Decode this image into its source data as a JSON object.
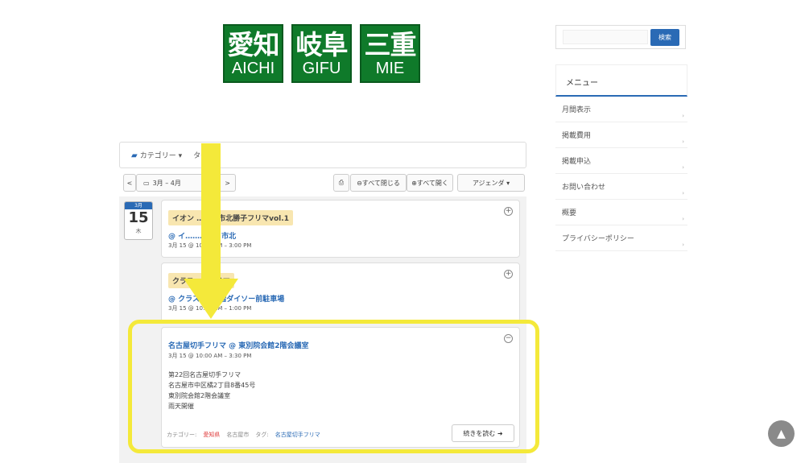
{
  "logos": [
    {
      "kanji": "愛知",
      "roman": "AICHI"
    },
    {
      "kanji": "岐阜",
      "roman": "GIFU"
    },
    {
      "kanji": "三重",
      "roman": "MIE"
    }
  ],
  "filter_bar": {
    "category_label": "カテゴリー ▾",
    "tag_label": "タグ ▾"
  },
  "nav": {
    "prev": "<",
    "range": "3月 – 4月",
    "next": ">",
    "print_icon": "printer-icon",
    "collapse_all": "⊖すべて閉じる",
    "expand_all": "⊕すべて開く",
    "view": "アジェンダ ▾"
  },
  "date_badge": {
    "month": "3月",
    "day": "15",
    "weekday": "木"
  },
  "events": [
    {
      "title": "イオン ……日市北勝子フリマvol.1",
      "location": "@ イ…………日市北",
      "time": "3月 15 @ 10:00 AM – 3:00 PM",
      "toggle": "+"
    },
    {
      "title": "クラス……フリマ",
      "location": "@ クラス……1階ダイソー前駐車場",
      "time": "3月 15 @ 10:00 AM – 1:00 PM",
      "toggle": "+"
    },
    {
      "title": "名古屋切手フリマ @ 東別院会館2階会議室",
      "time": "3月 15 @ 10:00 AM – 3:30 PM",
      "toggle": "−",
      "description": [
        "第22回名古屋切手フリマ",
        "名古屋市中区橘2丁目8番45号",
        "東別院会館2階会議室",
        "雨天開催"
      ],
      "footer": {
        "category_label": "カテゴリー:",
        "category_value": "愛知県",
        "city": "名古屋市",
        "tag_label": "タグ:",
        "tag_value": "名古屋切手フリマ"
      },
      "read_more": "続きを読む ➜"
    }
  ],
  "sidebar": {
    "search_placeholder": "",
    "search_button": "検索",
    "menu_title": "メニュー",
    "menu_items": [
      "月間表示",
      "掲載費用",
      "掲載申込",
      "お問い合わせ",
      "概要",
      "プライバシーポリシー"
    ]
  },
  "scroll_top": "▲",
  "colors": {
    "logo_green": "#0f7a2a",
    "accent_blue": "#2a6ab5",
    "highlight_yellow": "#f4e93a",
    "event_title_bg": "#f8e6b0"
  }
}
